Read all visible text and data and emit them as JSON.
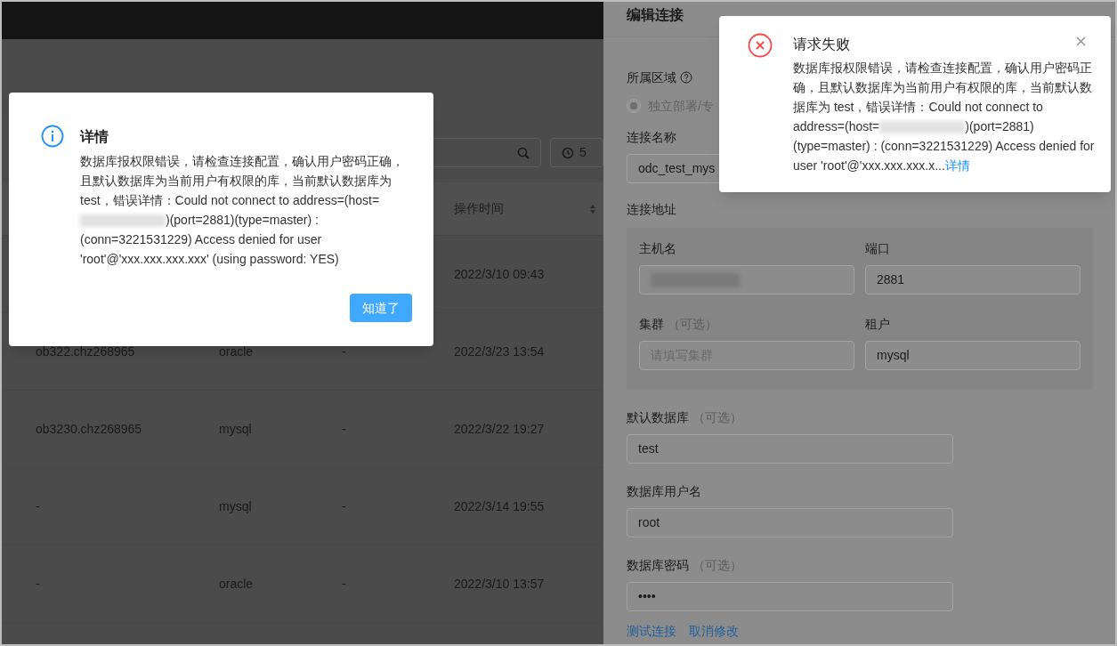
{
  "list_page": {
    "history_button": {
      "label": "5"
    },
    "table": {
      "columns": [
        {
          "label": "操作时间",
          "sortable": true
        }
      ],
      "rows": [
        {
          "time": "2022/3/10 09:43"
        },
        {
          "name": "ob322.chz268965",
          "mode": "oracle",
          "column_3": "-",
          "time": "2022/3/23 13:54"
        },
        {
          "name": "ob3230.chz268965",
          "mode": "mysql",
          "column_3": "-",
          "time": "2022/3/22 19:27"
        },
        {
          "name": "-",
          "mode": "mysql",
          "column_3": "-",
          "time": "2022/3/14 19:55"
        },
        {
          "name": "-",
          "mode": "oracle",
          "column_3": "-",
          "time": "2022/3/10 13:57"
        }
      ]
    }
  },
  "drawer": {
    "title": "编辑连接",
    "region": {
      "label": "所属区域",
      "option": {
        "label": "独立部署/专",
        "selected": true,
        "disabled": true
      }
    },
    "name_field": {
      "label": "连接名称",
      "value": "odc_test_mys"
    },
    "address": {
      "label": "连接地址",
      "fields": [
        {
          "label": "主机名",
          "value_redacted": true
        },
        {
          "label": "端口",
          "value": "2881"
        },
        {
          "label": "集群",
          "optional": "（可选）",
          "placeholder": "请填写集群"
        },
        {
          "label": "租户",
          "value": "mysql"
        }
      ]
    },
    "fields": [
      {
        "label": "默认数据库",
        "optional": "（可选）",
        "value": "test"
      },
      {
        "label": "数据库用户名",
        "value": "root"
      },
      {
        "label": "数据库密码",
        "optional": "（可选）",
        "value": "••••"
      }
    ],
    "links": [
      "测试连接",
      "取消修改"
    ]
  },
  "detail_dialog": {
    "title": "详情",
    "message_before": "数据库报权限错误，请检查连接配置，确认用户密码正确，且默认数据库为当前用户有权限的库，当前默认数据库为 test，错误详情：Could not connect to address=(host=",
    "message_after": ")(port=2881)(type=master) : (conn=3221531229) Access denied for user 'root'@'xxx.xxx.xxx.xxx' (using password: YES)",
    "button": "知道了"
  },
  "error_toast": {
    "title": "请求失败",
    "message_before": "数据库报权限错误，请检查连接配置，确认用户密码正确，且默认数据库为当前用户有权限的库，当前默认数据库为 test，错误详情：Could not connect to address=(host=",
    "message_after": ")(port=2881) (type=master) : (conn=3221531229) Access denied for user 'root'@'xxx.xxx.xxx.x...",
    "link": "详情"
  }
}
